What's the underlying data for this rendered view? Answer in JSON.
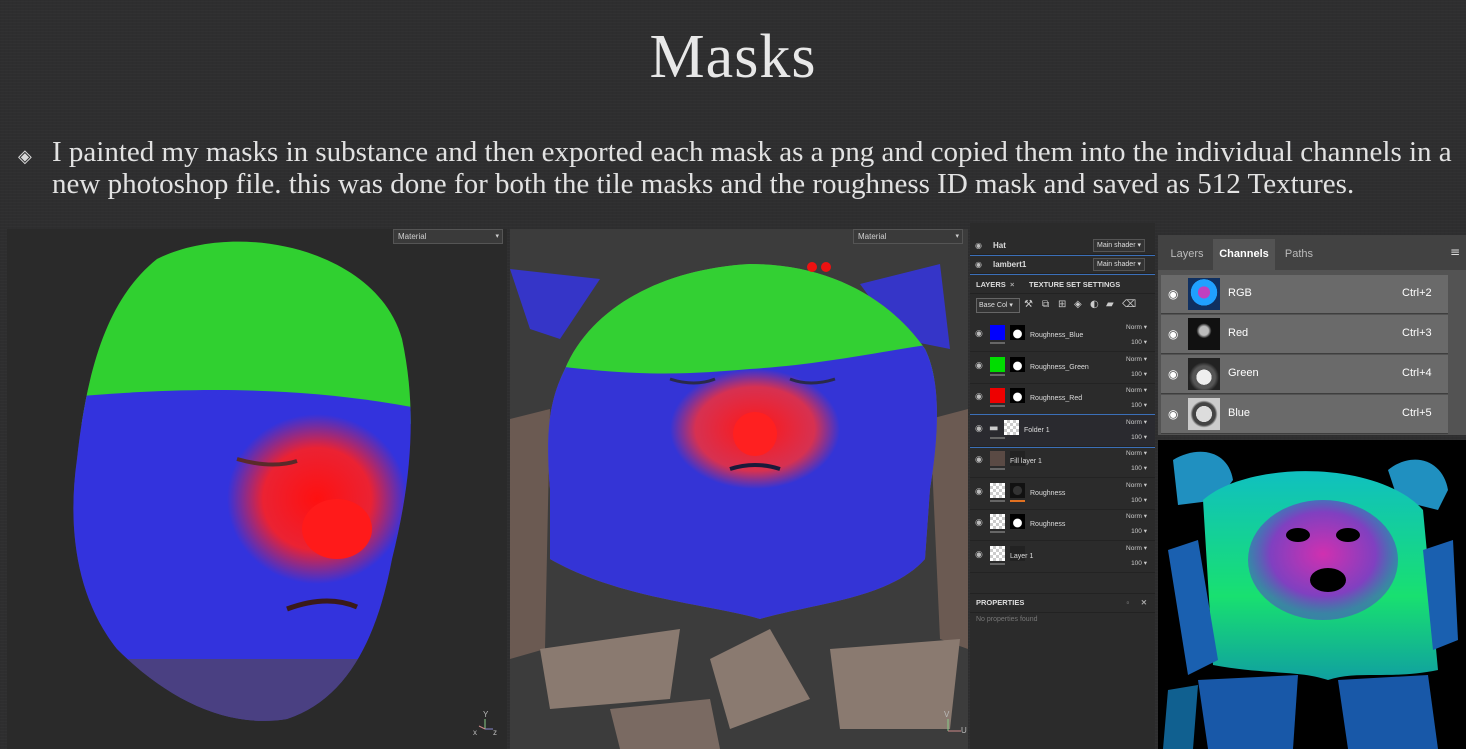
{
  "slide": {
    "title": "Masks",
    "bullet_icon": "diamond-bullet-icon",
    "bullet_text": "I painted my masks in substance and then exported each mask as a png and copied them into the individual channels in a new photoshop file. this was done for both the tile masks and the roughness ID mask and saved as 512 Textures."
  },
  "viewport_3d": {
    "dropdown": "Material",
    "axis": {
      "y": "Y",
      "x": "x",
      "z": "z"
    }
  },
  "viewport_2d": {
    "dropdown": "Material",
    "axis": {
      "v": "V",
      "u": "U"
    }
  },
  "substance_painter": {
    "texture_sets": [
      {
        "name": "Hat",
        "shader": "Main shader"
      },
      {
        "name": "lambert1",
        "shader": "Main shader"
      }
    ],
    "tabs": {
      "layers": "LAYERS",
      "close": "×",
      "texture_set_settings": "TEXTURE SET SETTINGS"
    },
    "channel_dropdown": "Base Col",
    "layers": [
      {
        "name": "Roughness_Blue",
        "blend": "Norm",
        "opacity": "100",
        "fill": "#0000ff"
      },
      {
        "name": "Roughness_Green",
        "blend": "Norm",
        "opacity": "100",
        "fill": "#00dd00"
      },
      {
        "name": "Roughness_Red",
        "blend": "Norm",
        "opacity": "100",
        "fill": "#ee0000"
      },
      {
        "name": "Folder 1",
        "blend": "Norm",
        "opacity": "100",
        "fill": "checker"
      },
      {
        "name": "Fill layer 1",
        "blend": "Norm",
        "opacity": "100",
        "fill": "#5a4a44"
      },
      {
        "name": "Roughness",
        "blend": "Norm",
        "opacity": "100",
        "fill": "checker"
      },
      {
        "name": "Roughness",
        "blend": "Norm",
        "opacity": "100",
        "fill": "checker"
      },
      {
        "name": "Layer 1",
        "blend": "Norm",
        "opacity": "100",
        "fill": "checker"
      }
    ],
    "properties": {
      "title": "PROPERTIES",
      "empty": "No properties found"
    }
  },
  "photoshop": {
    "tabs": [
      "Layers",
      "Channels",
      "Paths"
    ],
    "active_tab": "Channels",
    "channels": [
      {
        "name": "RGB",
        "shortcut": "Ctrl+2"
      },
      {
        "name": "Red",
        "shortcut": "Ctrl+3"
      },
      {
        "name": "Green",
        "shortcut": "Ctrl+4"
      },
      {
        "name": "Blue",
        "shortcut": "Ctrl+5"
      }
    ]
  }
}
